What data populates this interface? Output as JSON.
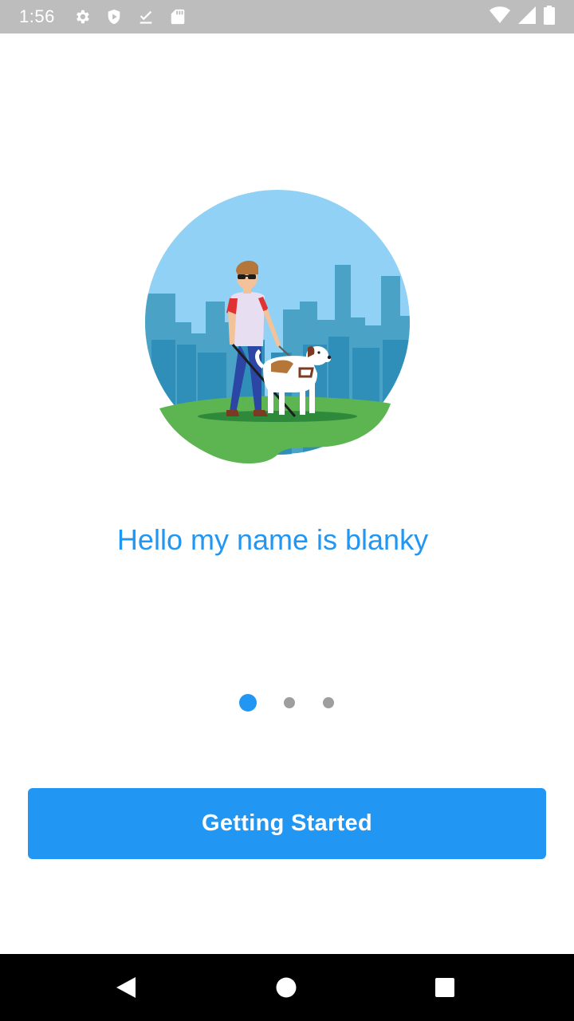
{
  "status_bar": {
    "time": "1:56",
    "left_icons": [
      "gear-icon",
      "shield-icon",
      "download-done-icon",
      "sd-card-icon"
    ],
    "right_icons": [
      "wifi-icon",
      "signal-icon",
      "battery-icon"
    ]
  },
  "onboarding": {
    "illustration": "person-with-guide-dog-illustration",
    "greeting": "Hello my name is blanky",
    "pager": {
      "pages": 3,
      "current": 1
    },
    "cta_label": "Getting Started"
  },
  "nav_bar": {
    "buttons": [
      "back-icon",
      "home-icon",
      "recents-icon"
    ]
  },
  "colors": {
    "accent": "#2196F3",
    "status_bar": "#bdbdbd",
    "inactive_dot": "#9e9e9e",
    "sky": "#90d1f5",
    "city": "#4aa3c7",
    "grass": "#5cb551"
  }
}
